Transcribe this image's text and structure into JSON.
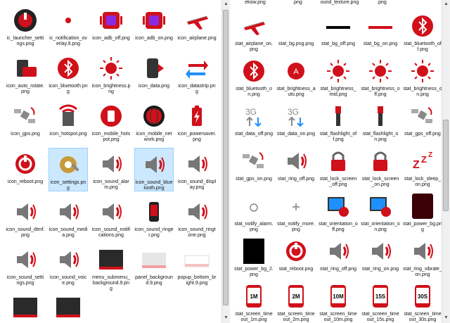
{
  "left_tiles": [
    {
      "label": "ic_launcher_settings.png",
      "icon": "power-red-icon"
    },
    {
      "label": "ic_notification_overlay.9.png",
      "icon": "red-dot-icon"
    },
    {
      "label": "icon_adb_off.png",
      "icon": "adb-robot-icon"
    },
    {
      "label": "icon_adb_on.png",
      "icon": "adb-robot-icon"
    },
    {
      "label": "icon_airplane.png",
      "icon": "airplane-icon"
    },
    {
      "label": "icon_auto_rotate.png",
      "icon": "auto-rotate-icon"
    },
    {
      "label": "icon_bluetooth.png",
      "icon": "bluetooth-icon"
    },
    {
      "label": "icon_brightness.png",
      "icon": "sun-icon"
    },
    {
      "label": "icon_data.png",
      "icon": "phone-data-icon"
    },
    {
      "label": "icon_datastrip.png",
      "icon": "datastrip-arrows-icon"
    },
    {
      "label": "icon_gps.png",
      "icon": "gps-satellite-icon"
    },
    {
      "label": "icon_hotspot.png",
      "icon": "hotspot-icon"
    },
    {
      "label": "icon_mobile_hotspot.png",
      "icon": "mobile-hotspot-icon"
    },
    {
      "label": "icon_mobile_network.png",
      "icon": "globe-network-icon"
    },
    {
      "label": "icon_powersaver.png",
      "icon": "battery-icon"
    },
    {
      "label": "icon_reboot.png",
      "icon": "reboot-icon"
    },
    {
      "label": "icon_settings.png",
      "icon": "settings-gear-icon"
    },
    {
      "label": "icon_sound_alarm.png",
      "icon": "speaker-alarm-icon"
    },
    {
      "label": "icon_sound_bluetooth.png",
      "icon": "speaker-bluetooth-icon"
    },
    {
      "label": "icon_sound_display.png",
      "icon": "speaker-display-icon"
    },
    {
      "label": "icon_sound_dtmf.png",
      "icon": "speaker-dtmf-icon"
    },
    {
      "label": "icon_sound_media.png",
      "icon": "speaker-media-icon"
    },
    {
      "label": "icon_sound_notifications.png",
      "icon": "speaker-notification-icon"
    },
    {
      "label": "icon_sound_ringer.png",
      "icon": "phone-ringer-icon"
    },
    {
      "label": "icon_sound_ringtone.png",
      "icon": "speaker-music-icon"
    },
    {
      "label": "icon_sound_settings.png",
      "icon": "speaker-settings-icon"
    },
    {
      "label": "icon_sound_voice.png",
      "icon": "speaker-voice-icon"
    },
    {
      "label": "menu_submenu_background.9.png",
      "icon": "dark-panel-icon"
    },
    {
      "label": "panel_background.9.png",
      "icon": "light-panel-icon"
    },
    {
      "label": "popup_bottom_bright.9.png",
      "icon": "popup-bottom-icon"
    },
    {
      "label": "",
      "icon": "dark-panel-icon"
    },
    {
      "label": "",
      "icon": "dark-panel-icon"
    }
  ],
  "right_partial_labels": [
    "ekow.png",
    ".png",
    "ound_texture.png",
    ".png"
  ],
  "right_tiles": [
    {
      "label": "stat_airplane_on.png",
      "icon": "airplane-icon"
    },
    {
      "label": "stat_bg.png.png",
      "icon": "blank-icon"
    },
    {
      "label": "stat_bg_off.png",
      "icon": "black-bar-icon"
    },
    {
      "label": "stat_bg_on.png",
      "icon": "red-bar-icon"
    },
    {
      "label": "stat_bluetooth_off.png",
      "icon": "bluetooth-icon"
    },
    {
      "label": "stat_bluetooth_on.png",
      "icon": "bluetooth-icon"
    },
    {
      "label": "stat_brightness_auto.png",
      "icon": "brightness-auto-icon"
    },
    {
      "label": "stat_brightness_mid.png",
      "icon": "sun-icon"
    },
    {
      "label": "stat_brightness_off.png",
      "icon": "sun-icon"
    },
    {
      "label": "stat_brightness_on.png",
      "icon": "sun-icon"
    },
    {
      "label": "stat_data_off.png",
      "icon": "data-3g-icon"
    },
    {
      "label": "stat_data_on.png",
      "icon": "data-3g-icon"
    },
    {
      "label": "stat_flashlight_off.png",
      "icon": "flashlight-icon"
    },
    {
      "label": "stat_flashlight_on.png",
      "icon": "flashlight-icon"
    },
    {
      "label": "stat_gps_off.png",
      "icon": "gps-satellite-icon"
    },
    {
      "label": "stat_gps_on.png",
      "icon": "gps-satellite-icon"
    },
    {
      "label": "stat_ring_off.png",
      "icon": "speaker-icon"
    },
    {
      "label": "stat_lock_screen_off.png",
      "icon": "padlock-icon"
    },
    {
      "label": "stat_lock_screen_on.png",
      "icon": "padlock-icon"
    },
    {
      "label": "stat_lock_sleep_on.png",
      "icon": "sleep-zzz-icon"
    },
    {
      "label": "stat_notify_alarm.png",
      "icon": "alarm-clock-icon"
    },
    {
      "label": "stat_notify_more.png",
      "icon": "plus-icon"
    },
    {
      "label": "stat_orientation_off.png",
      "icon": "orientation-icon"
    },
    {
      "label": "stat_orientation_on.png",
      "icon": "orientation-icon"
    },
    {
      "label": "stat_power_bg.png",
      "icon": "power-bg-icon"
    },
    {
      "label": "stat_power_bg_2.png",
      "icon": "black-panel-icon"
    },
    {
      "label": "stat_reboot.png",
      "icon": "reboot-icon"
    },
    {
      "label": "stat_ring_off.png",
      "icon": "speaker-icon"
    },
    {
      "label": "stat_ring_on.png",
      "icon": "speaker-icon"
    },
    {
      "label": "stat_ring_vibrate_on.png",
      "icon": "speaker-vibrate-icon"
    },
    {
      "label": "stat_screen_timeout_1m.png",
      "icon": "phone-timeout-icon",
      "badge": "1M"
    },
    {
      "label": "stat_screen_timeout_2m.png",
      "icon": "phone-timeout-icon",
      "badge": "2M"
    },
    {
      "label": "stat_screen_timeout_10m.png",
      "icon": "phone-timeout-icon",
      "badge": "10M"
    },
    {
      "label": "stat_screen_timeout_15s.png",
      "icon": "phone-timeout-icon",
      "badge": "15S"
    },
    {
      "label": "stat_screen_timeout_30s.png",
      "icon": "phone-timeout-icon",
      "badge": "30S"
    }
  ],
  "colors": {
    "accent": "#d0101a",
    "selection": "#cce8ff",
    "selection_border": "#99d1ff"
  }
}
